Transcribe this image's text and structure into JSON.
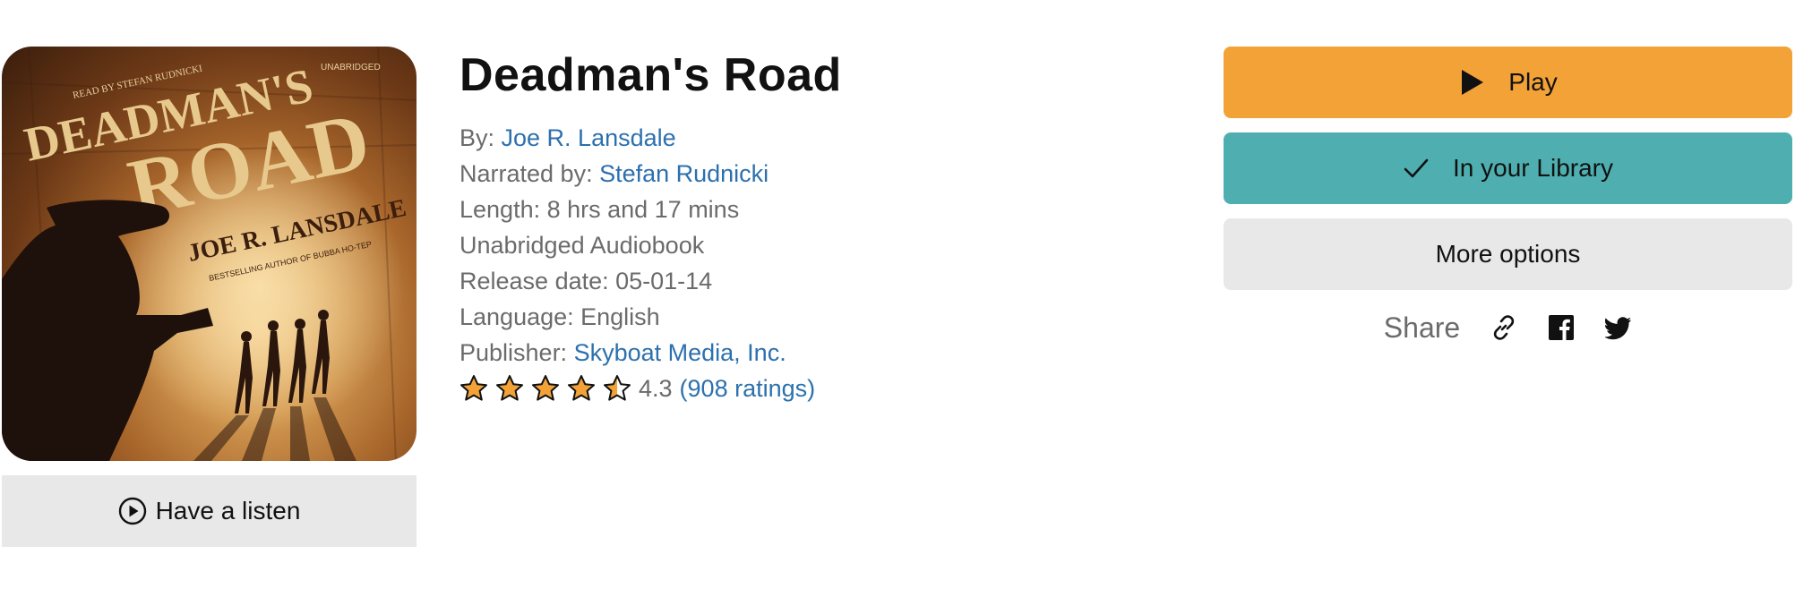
{
  "book": {
    "title": "Deadman's Road",
    "author_prefix": "By: ",
    "author": "Joe R. Lansdale",
    "narrator_prefix": "Narrated by: ",
    "narrator": "Stefan Rudnicki",
    "length": "Length: 8 hrs and 17 mins",
    "format": "Unabridged Audiobook",
    "release": "Release date: 05-01-14",
    "language": "Language: English",
    "publisher_prefix": "Publisher: ",
    "publisher": "Skyboat Media, Inc.",
    "rating_value": "4.3",
    "rating_count": "(908 ratings)",
    "stars": 4.3
  },
  "cover": {
    "alt": "Deadman's Road cover",
    "read_by": "READ BY STEFAN RUDNICKI",
    "unabridged": "UNABRIDGED",
    "line1": "DEADMAN'S",
    "line2": "ROAD",
    "author": "JOE R. LANSDALE",
    "tagline": "BESTSELLING AUTHOR OF BUBBA HO-TEP"
  },
  "buttons": {
    "have_listen": "Have a listen",
    "play": "Play",
    "library": "In your Library",
    "more": "More options"
  },
  "share": {
    "label": "Share",
    "icons": [
      "link-icon",
      "facebook-icon",
      "twitter-icon"
    ]
  },
  "colors": {
    "play": "#f2a237",
    "library": "#4fafb0",
    "link": "#2c70ad",
    "star_fill": "#f2a237"
  }
}
